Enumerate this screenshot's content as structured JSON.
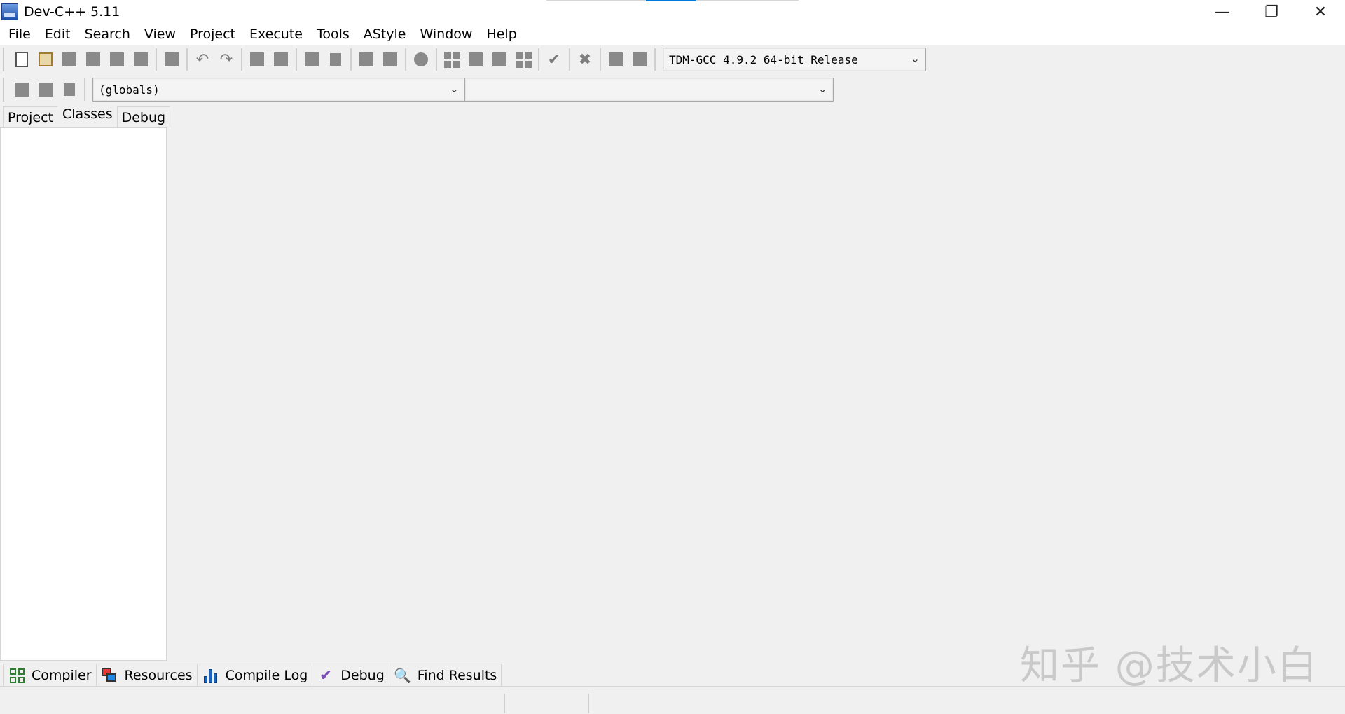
{
  "window": {
    "title": "Dev-C++ 5.11",
    "controls": {
      "minimize": "—",
      "restore": "❐",
      "close": "✕"
    }
  },
  "menu": {
    "items": [
      "File",
      "Edit",
      "Search",
      "View",
      "Project",
      "Execute",
      "Tools",
      "AStyle",
      "Window",
      "Help"
    ]
  },
  "toolbar": {
    "compiler_select": "TDM-GCC 4.9.2 64-bit Release",
    "scope_select": "(globals)",
    "member_select": ""
  },
  "left_panel": {
    "tabs": [
      "Project",
      "Classes",
      "Debug"
    ],
    "active_tab": "Classes"
  },
  "bottom_tabs": [
    "Compiler",
    "Resources",
    "Compile Log",
    "Debug",
    "Find Results"
  ],
  "watermark": "知乎 @技术小白",
  "icons": {
    "undo": "↶",
    "redo": "↷",
    "check": "✔",
    "cross": "✖",
    "chevron": "⌄",
    "magnifier": "🔍"
  }
}
